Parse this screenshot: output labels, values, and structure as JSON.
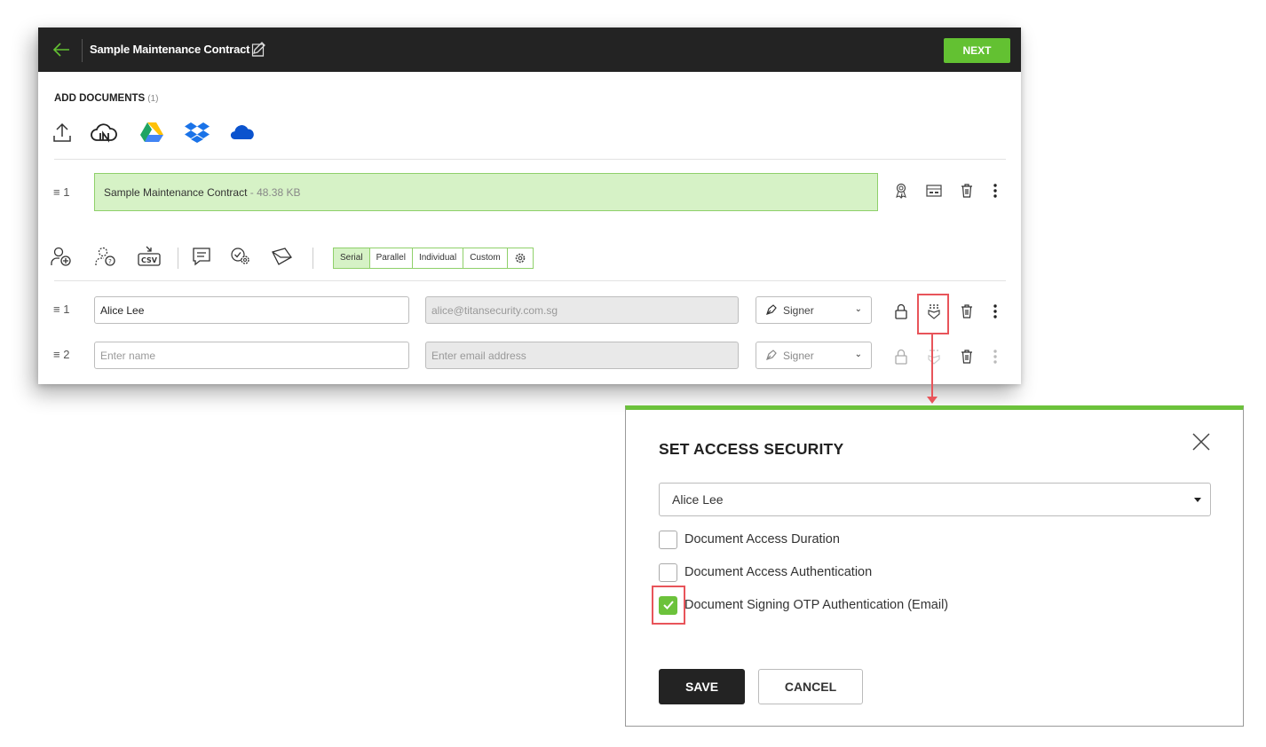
{
  "header": {
    "title": "Sample Maintenance Contract",
    "next_label": "NEXT",
    "back_icon": "arrow-left-icon",
    "edit_icon": "pencil-edit-icon"
  },
  "add_documents": {
    "label": "ADD DOCUMENTS",
    "count": "(1)",
    "sources": [
      "upload-icon",
      "cloud-storage-icon",
      "google-drive-icon",
      "dropbox-icon",
      "onedrive-icon"
    ]
  },
  "documents": [
    {
      "index": "1",
      "name": "Sample Maintenance Contract",
      "size": " - 48.38 KB"
    }
  ],
  "doc_actions": [
    "certificate-icon",
    "fields-icon",
    "trash-icon",
    "more-vertical-icon"
  ],
  "recipient_tools": [
    "add-recipient-icon",
    "add-optional-recipient-icon",
    "import-csv-icon",
    "message-icon",
    "settings-check-icon",
    "email-icon"
  ],
  "signing_order": {
    "options": [
      "Serial",
      "Parallel",
      "Individual",
      "Custom"
    ],
    "selected": "Serial"
  },
  "recipients": [
    {
      "index": "1",
      "name": "Alice Lee",
      "name_placeholder": "Enter name",
      "email": "alice@titansecurity.com.sg",
      "role": "Signer"
    },
    {
      "index": "2",
      "name": "",
      "name_placeholder": "Enter name",
      "email": "Enter email address",
      "role": "Signer"
    }
  ],
  "modal": {
    "title": "SET ACCESS SECURITY",
    "selected_signer": "Alice Lee",
    "options": [
      {
        "label": "Document Access Duration",
        "checked": false
      },
      {
        "label": "Document Access Authentication",
        "checked": false
      },
      {
        "label": "Document Signing OTP Authentication (Email)",
        "checked": true
      }
    ],
    "save_label": "SAVE",
    "cancel_label": "CANCEL"
  },
  "colors": {
    "accent": "#63c132",
    "header_bg": "#232323",
    "doc_bg": "#d6f2c6",
    "highlight": "#e8545a"
  }
}
